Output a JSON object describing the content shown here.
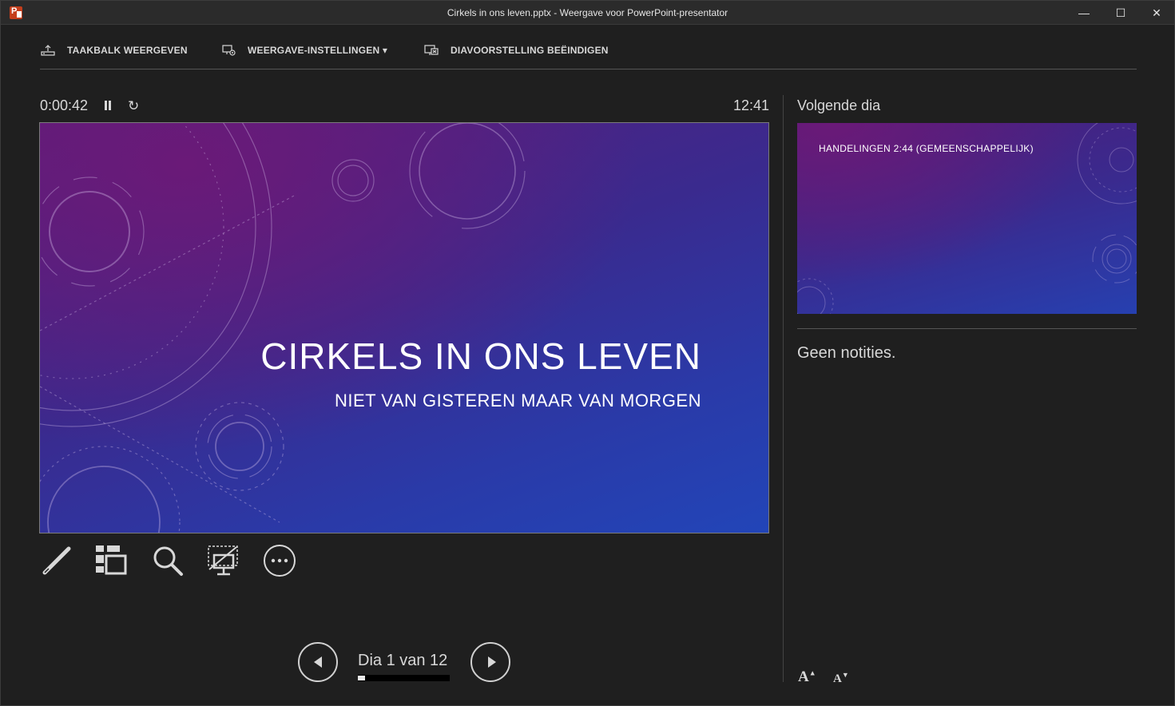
{
  "window": {
    "title": "Cirkels in ons leven.pptx - Weergave voor PowerPoint-presentator",
    "controls": {
      "minimize": "—",
      "maximize": "☐",
      "close": "✕"
    }
  },
  "toolbar": {
    "taskbar_label": "TAAKBALK WEERGEVEN",
    "display_settings_label": "WEERGAVE-INSTELLINGEN ▾",
    "end_show_label": "DIAVOORSTELLING BEËINDIGEN"
  },
  "timer": {
    "elapsed": "0:00:42",
    "clock": "12:41",
    "reset_glyph": "↻"
  },
  "current_slide": {
    "title": "CIRKELS IN ONS LEVEN",
    "subtitle": "NIET VAN GISTEREN MAAR VAN MORGEN"
  },
  "next_slide": {
    "label": "Volgende dia",
    "title": "HANDELINGEN 2:44 (GEMEENSCHAPPELIJK)"
  },
  "notes": {
    "text": "Geen notities."
  },
  "navigation": {
    "counter": "Dia 1 van 12",
    "current": 1,
    "total": 12
  },
  "font_controls": {
    "increase": "A",
    "decrease": "A"
  },
  "icons": {
    "tools": [
      "pen-icon",
      "slides-grid-icon",
      "zoom-icon",
      "black-screen-icon",
      "more-options-icon"
    ]
  },
  "colors": {
    "background": "#1f1f1f",
    "titlebar": "#2b2b2b",
    "app_icon": "#c43e1c"
  }
}
